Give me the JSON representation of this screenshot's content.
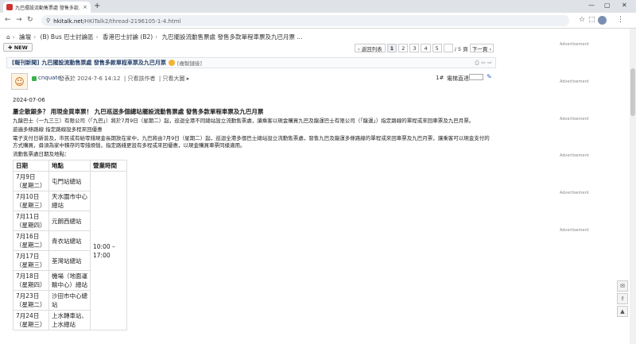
{
  "browser": {
    "tab_title": "九巴擺設流動售票處 發售多款…",
    "tab_close": "×",
    "new_tab": "+",
    "win_min": "—",
    "win_max": "▢",
    "win_close": "✕",
    "back": "←",
    "forward": "→",
    "reload": "↻",
    "url_host": "hkitalk.net",
    "url_path": "/HKiTalk2/thread-2196105-1-4.html"
  },
  "breadcrumb": [
    "論壇",
    "(B) Bus 巴士討論區",
    "香港巴士討論 (B2)",
    "九巴擺設流動售票處 發售多款單程車票及九巴月票 ..."
  ],
  "new_button": "NEW",
  "pager": {
    "back": "‹ 返回列表",
    "pages": [
      "1",
      "2",
      "3",
      "4",
      "5"
    ],
    "total": "/ 5 頁",
    "next": "下一頁 ›"
  },
  "thread": {
    "tag": "[報刊新聞]",
    "title": "九巴擺設流動售票處 發售多款單程車票及九巴月票",
    "copy_link": "[複製鏈接]"
  },
  "post": {
    "username": "cnquate",
    "posted": "發表於 2024-7-6 14:12",
    "only_author": "只看該作者",
    "large_image": "只看大圖 ▸",
    "floor": "1#",
    "jump_label": "電梯直達"
  },
  "content": {
    "date": "2024-07-06",
    "headline": "屢企散銀多？ 用現金買車票！ 九巴巡迴多個總站擺設流動售票處 發售多款單程車票及九巴月票",
    "paragraphs": [
      "九龍巴士（一九三三）有限公司（「九巴」）將於7月9日（星期二）起，巡迴全港不同總站設立流動售票處，讓乘客以現金購買九巴及龍運巴士有限公司（「龍運」）指定路線的單程或來回車票及九巴月票。",
      "遊遍多條路線 指定路線設多程來回優惠",
      "電子支付日新普及，市民或有給零錢現金長期放在家中，九巴將由7月9日（星期二）起，巡迴全港多個巴士總站設立流動售票處，發售九巴及龍運多條路線的單程或來回車票及九巴月票，讓乘客可以現金支付的方式購買，毋須為家中積存的零錢煩惱，指定路綫更設有多程或來回優惠，以現金購買車票同樣適用。",
      "流動售票處日期及地點："
    ]
  },
  "table": {
    "headers": [
      "日期",
      "地點",
      "營業時間"
    ],
    "rows": [
      {
        "date": "7月9日（星期二）",
        "place": "屯門站總站"
      },
      {
        "date": "7月10日（星期三）",
        "place": "天水圍市中心總站"
      },
      {
        "date": "7月11日（星期四）",
        "place": "元朗西總站"
      },
      {
        "date": "7月16日（星期二）",
        "place": "青衣站總站"
      },
      {
        "date": "7月17日（星期三）",
        "place": "荃灣站總站"
      },
      {
        "date": "7月18日（星期四）",
        "place": "機場（地面運輸中心）總站"
      },
      {
        "date": "7月23日（星期二）",
        "place": "沙田市中心總站"
      },
      {
        "date": "7月24日（星期三）",
        "place": "上水轉車站、上水總站"
      }
    ],
    "hours": "10:00 – 17:00"
  },
  "ads": [
    "Advertisement",
    "Advertisement",
    "Advertisement",
    "Advertisement",
    "Advertisement",
    "Advertisement"
  ]
}
